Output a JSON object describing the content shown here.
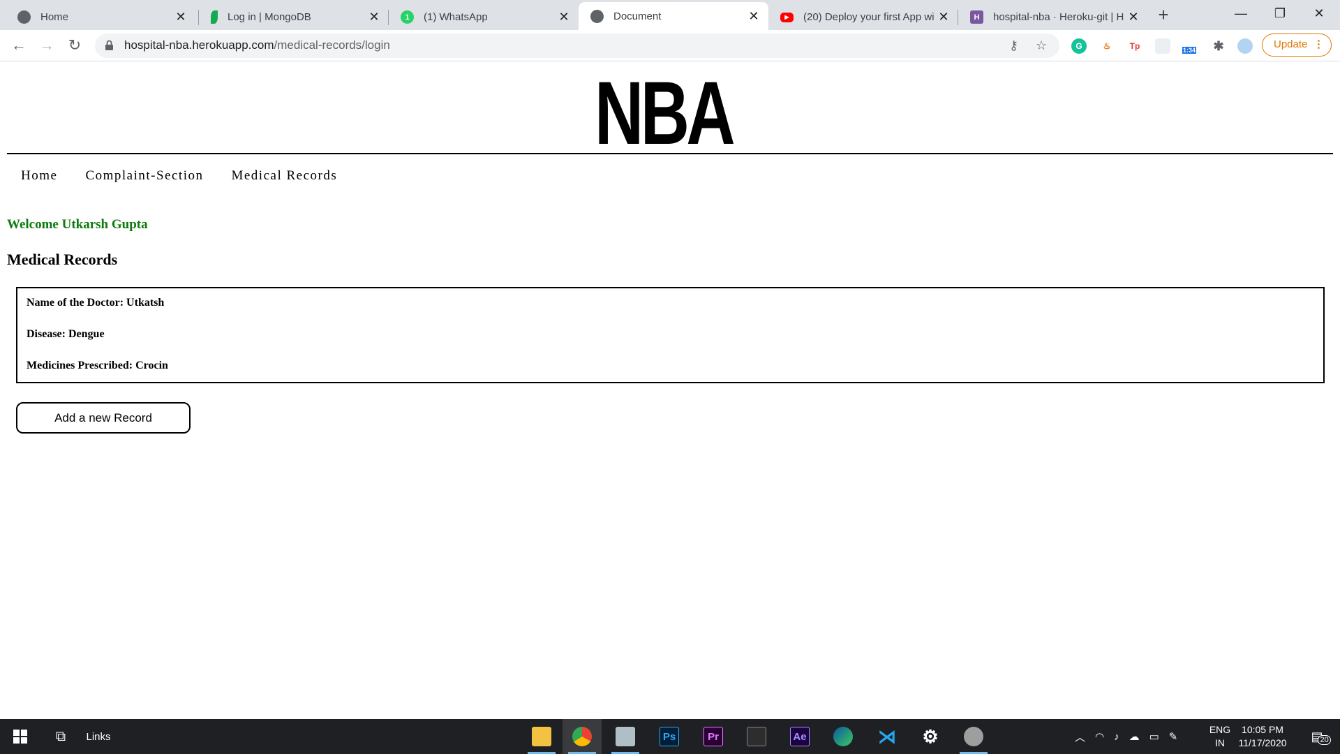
{
  "browser": {
    "tabs": [
      {
        "title": "Home",
        "favicon": "globe-icon",
        "color": "#5f6368",
        "active": false
      },
      {
        "title": "Log in | MongoDB",
        "favicon": "mongodb-leaf-icon",
        "color": "#13aa52",
        "active": false
      },
      {
        "title": "(1) WhatsApp",
        "favicon": "whatsapp-icon",
        "color": "#25d366",
        "active": false
      },
      {
        "title": "Document",
        "favicon": "globe-icon",
        "color": "#5f6368",
        "active": true
      },
      {
        "title": "(20) Deploy your first App wi",
        "favicon": "youtube-icon",
        "color": "#ff0000",
        "active": false
      },
      {
        "title": "hospital-nba · Heroku-git | H",
        "favicon": "heroku-icon",
        "color": "#79589f",
        "active": false
      }
    ],
    "new_tab_label": "+",
    "url_host": "hospital-nba.herokuapp.com",
    "url_path": "/medical-records/login",
    "update_label": "Update",
    "extension_badge": "1:34"
  },
  "site": {
    "logo": "NBA",
    "nav": [
      "Home",
      "Complaint-Section",
      "Medical Records"
    ],
    "welcome": "Welcome Utkarsh Gupta",
    "section_title": "Medical Records",
    "record": {
      "doctor": "Name of the Doctor: Utkatsh",
      "disease": "Disease: Dengue",
      "medicines": "Medicines Prescribed: Crocin"
    },
    "add_button": "Add a new Record",
    "colors": {
      "welcome": "#0a7a0a"
    }
  },
  "taskbar": {
    "links_label": "Links",
    "apps": [
      "file-explorer-icon",
      "chrome-icon",
      "photos-icon",
      "photoshop-icon",
      "premiere-icon",
      "app-icon",
      "after-effects-icon",
      "edge-icon",
      "vscode-icon",
      "settings-icon",
      "installer-icon"
    ],
    "app_labels": {
      "photoshop": "Ps",
      "premiere": "Pr",
      "after_effects": "Ae"
    },
    "lang_top": "ENG",
    "lang_bottom": "IN",
    "time": "10:05 PM",
    "date": "11/17/2020",
    "notifications": "20"
  }
}
